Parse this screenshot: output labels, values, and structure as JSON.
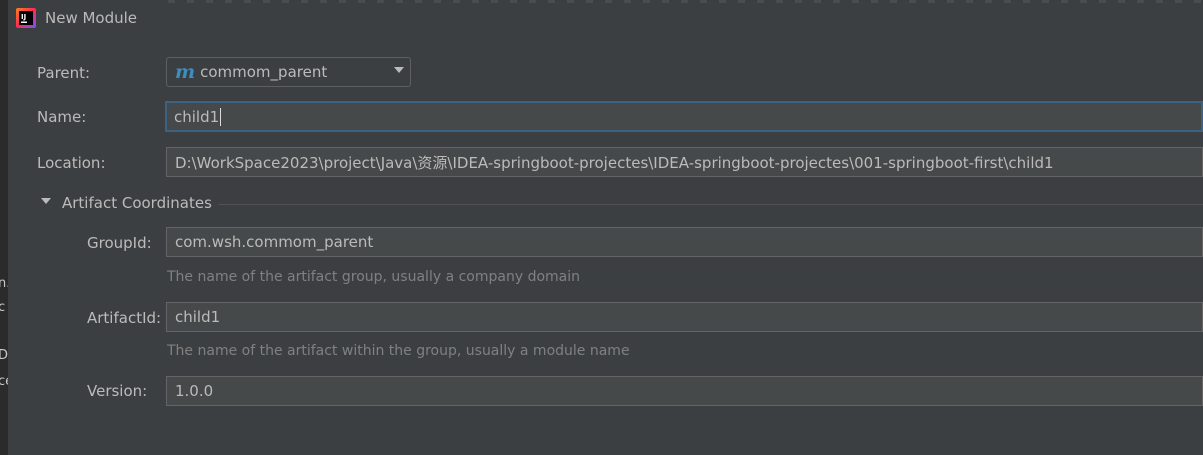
{
  "window": {
    "title": "New Module"
  },
  "background_fragments": [
    "n.",
    "c",
    "De",
    "ce"
  ],
  "form": {
    "parent": {
      "label": "Parent:",
      "value": "commom_parent",
      "icon": "maven-module-icon"
    },
    "name": {
      "label": "Name:",
      "value": "child1"
    },
    "location": {
      "label": "Location:",
      "value": "D:\\WorkSpace2023\\project\\Java\\资源\\IDEA-springboot-projectes\\IDEA-springboot-projectes\\001-springboot-first\\child1"
    }
  },
  "artifact": {
    "section_title": "Artifact Coordinates",
    "group_id": {
      "label": "GroupId:",
      "value": "com.wsh.commom_parent",
      "hint": "The name of the artifact group, usually a company domain"
    },
    "artifact_id": {
      "label": "ArtifactId:",
      "value": "child1",
      "hint": "The name of the artifact within the group, usually a module name"
    },
    "version": {
      "label": "Version:",
      "value": "1.0.0"
    }
  },
  "colors": {
    "background": "#3c3f41",
    "field_bg": "#45494a",
    "focus_border": "#3d6185",
    "text": "#bbbbbb",
    "hint_text": "#808080",
    "maven_icon": "#3b8ec1"
  }
}
